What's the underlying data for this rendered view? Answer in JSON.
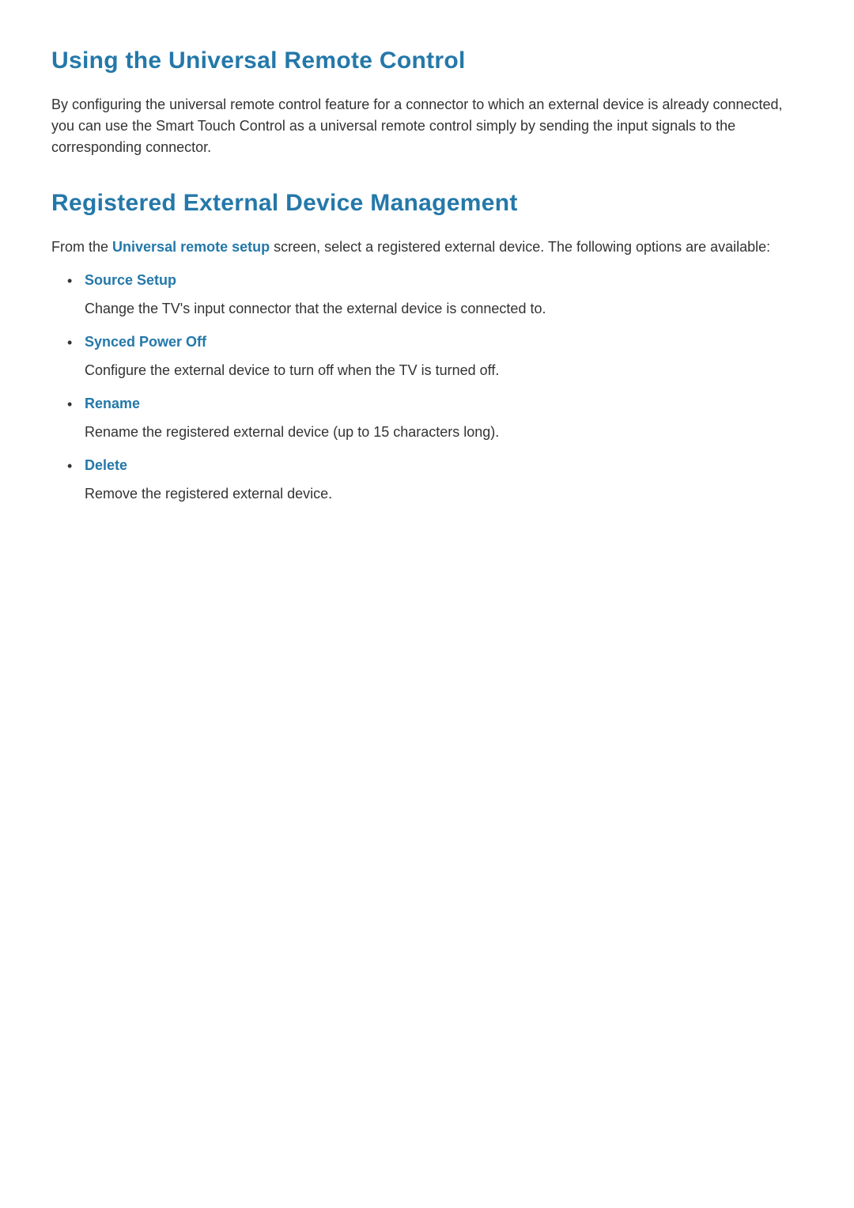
{
  "section1": {
    "heading": "Using the Universal Remote Control",
    "body": "By configuring the universal remote control feature for a connector to which an external device is already connected, you can use the Smart Touch Control as a universal remote control simply by sending the input signals to the corresponding connector."
  },
  "section2": {
    "heading": "Registered External Device Management",
    "intro_pre": "From the ",
    "intro_emph": "Universal remote setup",
    "intro_post": " screen, select a registered external device. The following options are available:",
    "options": [
      {
        "title": "Source Setup",
        "desc": "Change the TV's input connector that the external device is connected to."
      },
      {
        "title": "Synced Power Off",
        "desc": "Configure the external device to turn off when the TV is turned off."
      },
      {
        "title": "Rename",
        "desc": "Rename the registered external device (up to 15 characters long)."
      },
      {
        "title": "Delete",
        "desc": "Remove the registered external device."
      }
    ]
  }
}
